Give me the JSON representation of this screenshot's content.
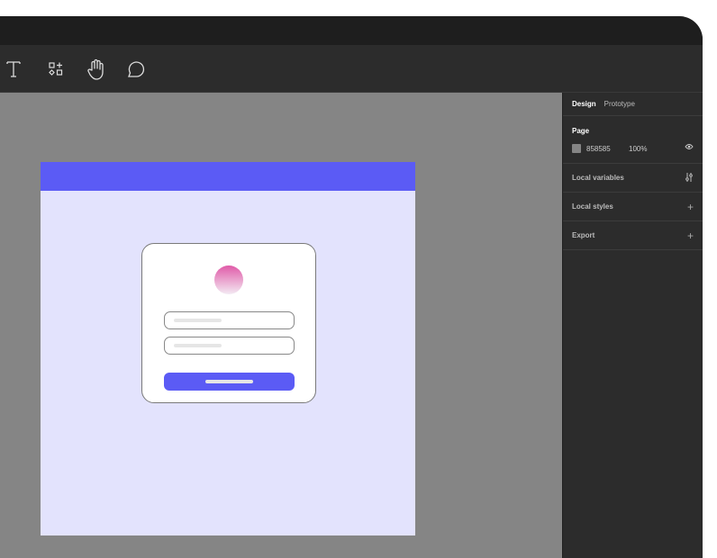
{
  "toolbar": {
    "tools": [
      "text-tool",
      "shapes-tool",
      "hand-tool",
      "comment-tool"
    ]
  },
  "panel": {
    "tabs": [
      "Design",
      "Prototype"
    ],
    "page": {
      "title": "Page",
      "color_hex": "858585",
      "opacity": "100%"
    },
    "sections": [
      "Local variables",
      "Local styles",
      "Export"
    ]
  },
  "colors": {
    "canvas": "#858585",
    "accent": "#5b5bf5",
    "frame_bg": "#e3e3fd"
  }
}
